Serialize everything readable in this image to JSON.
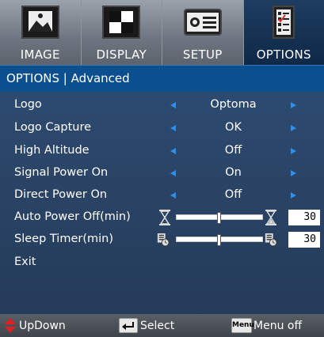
{
  "tabs": [
    {
      "label": "IMAGE",
      "icon": "image-icon"
    },
    {
      "label": "DISPLAY",
      "icon": "display-icon"
    },
    {
      "label": "SETUP",
      "icon": "setup-icon"
    },
    {
      "label": "OPTIONS",
      "icon": "options-icon",
      "active": true
    }
  ],
  "header": {
    "title": "OPTIONS | Advanced"
  },
  "menu": {
    "logo": {
      "label": "Logo",
      "value": "Optoma"
    },
    "logo_capture": {
      "label": "Logo Capture",
      "value": "OK"
    },
    "high_altitude": {
      "label": "High Altitude",
      "value": "Off"
    },
    "signal_power_on": {
      "label": "Signal Power On",
      "value": "On"
    },
    "direct_power_on": {
      "label": "Direct Power On",
      "value": "Off"
    },
    "auto_power_off": {
      "label": "Auto Power Off(min)",
      "value": "30",
      "level": 0.5
    },
    "sleep_timer": {
      "label": "Sleep Timer(min)",
      "value": "30",
      "level": 0.5
    },
    "exit": {
      "label": "Exit"
    }
  },
  "footer": {
    "updown": "UpDown",
    "select": "Select",
    "menu_key": "Menu",
    "menu_off": "Menu off"
  },
  "colors": {
    "accent": "#2f8fe8",
    "header": "#0b4f8e",
    "panel": "#2c4a70",
    "active_tab": "#0e2848"
  }
}
